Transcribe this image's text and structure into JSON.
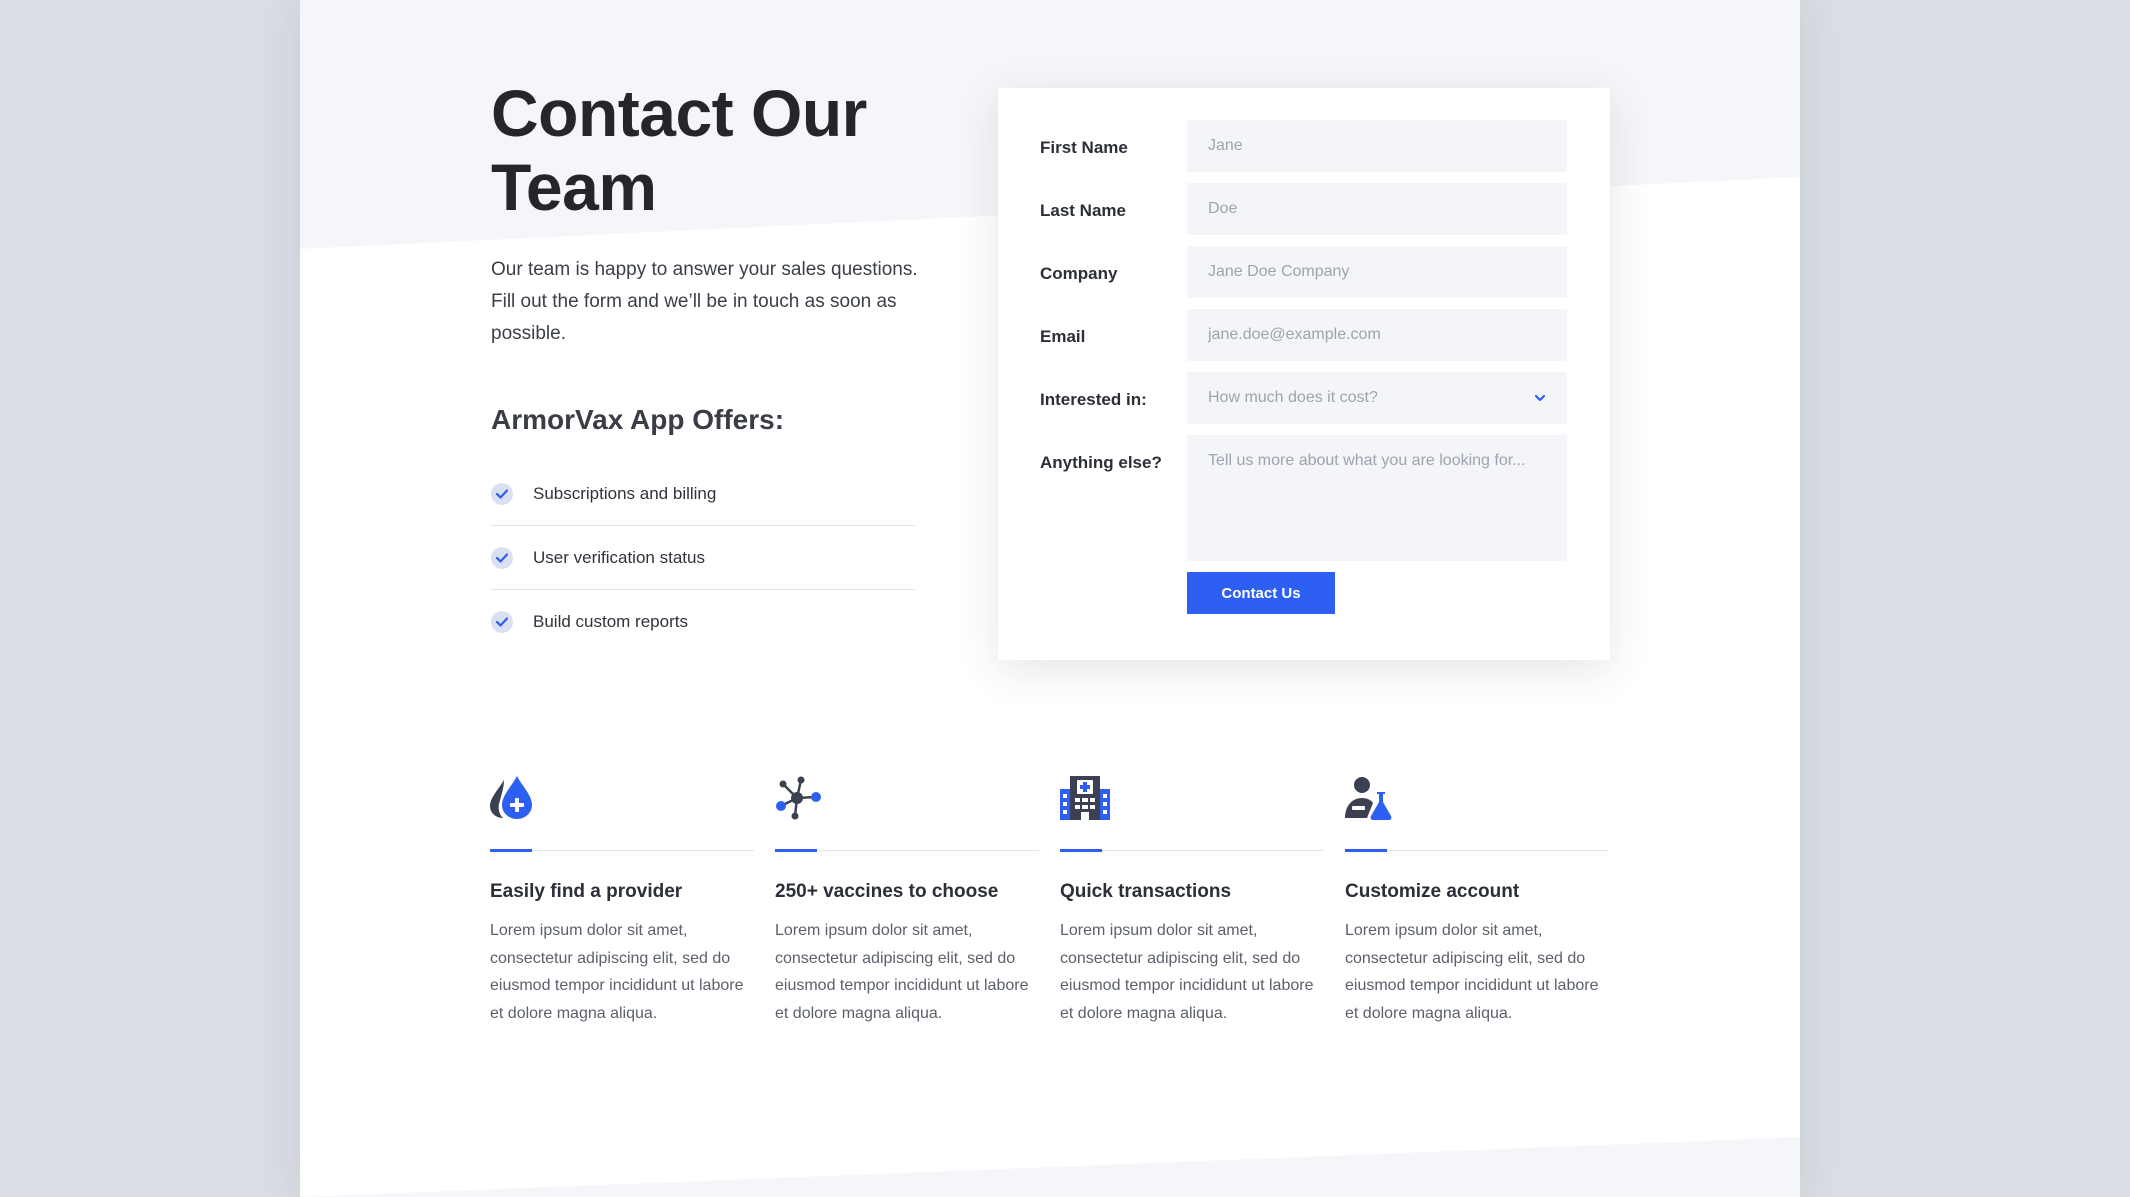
{
  "hero": {
    "title": "Contact Our Team",
    "description": "Our team is happy to answer your sales questions. Fill out the form and we’ll be in touch as soon as possible."
  },
  "offers": {
    "title": "ArmorVax App Offers:",
    "items": [
      {
        "label": "Subscriptions and billing"
      },
      {
        "label": "User verification status"
      },
      {
        "label": "Build custom reports"
      }
    ]
  },
  "form": {
    "first_name": {
      "label": "First Name",
      "placeholder": "Jane"
    },
    "last_name": {
      "label": "Last Name",
      "placeholder": "Doe"
    },
    "company": {
      "label": "Company",
      "placeholder": "Jane Doe Company"
    },
    "email": {
      "label": "Email",
      "placeholder": "jane.doe@example.com"
    },
    "interested": {
      "label": "Interested in:",
      "value": "How much does it cost?"
    },
    "anything": {
      "label": "Anything else?",
      "placeholder": "Tell us more about what you are looking for..."
    },
    "submit_label": "Contact Us"
  },
  "features": [
    {
      "icon": "drop-plus-icon",
      "title": "Easily find a provider",
      "desc": "Lorem ipsum dolor sit amet, consectetur adipiscing elit, sed do eiusmod tempor incididunt ut labore et dolore magna aliqua."
    },
    {
      "icon": "molecule-icon",
      "title": "250+ vaccines to choose",
      "desc": "Lorem ipsum dolor sit amet, consectetur adipiscing elit, sed do eiusmod tempor incididunt ut labore et dolore magna aliqua."
    },
    {
      "icon": "hospital-icon",
      "title": "Quick transactions",
      "desc": "Lorem ipsum dolor sit amet, consectetur adipiscing elit, sed do eiusmod tempor incididunt ut labore et dolore magna aliqua."
    },
    {
      "icon": "scientist-icon",
      "title": "Customize account",
      "desc": "Lorem ipsum dolor sit amet, consectetur adipiscing elit, sed do eiusmod tempor incididunt ut labore et dolore magna aliqua."
    }
  ],
  "colors": {
    "accent": "#2d5ff2",
    "icon_dark": "#3b4152",
    "background": "#d9dde4"
  }
}
